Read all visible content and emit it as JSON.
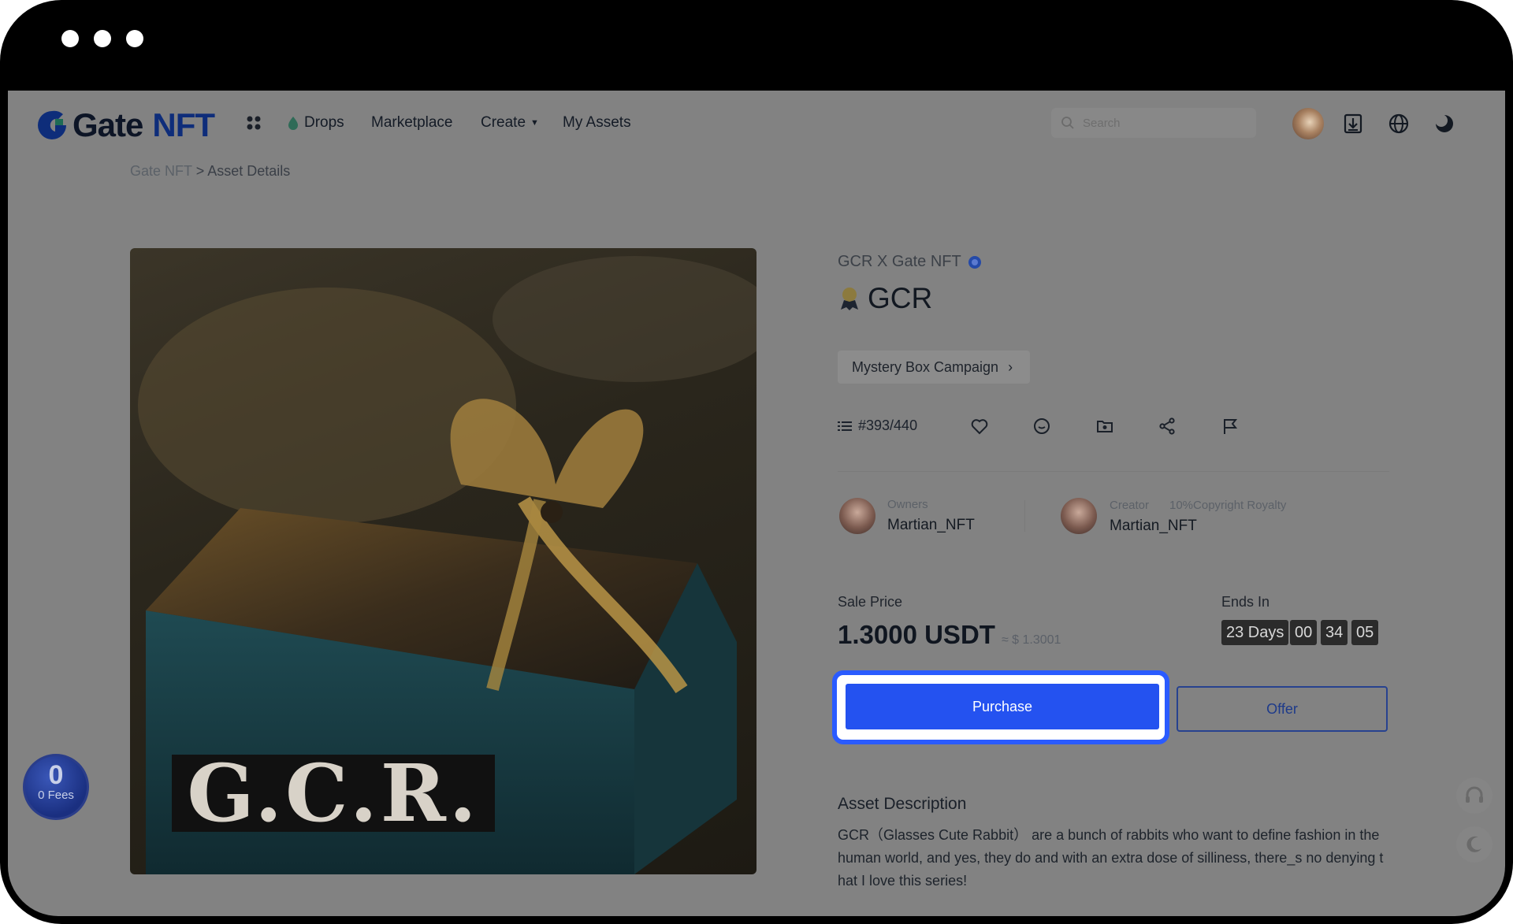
{
  "header": {
    "logo_text": "Gate",
    "logo_text2": "NFT",
    "nav": [
      {
        "label": "Drops"
      },
      {
        "label": "Marketplace"
      },
      {
        "label": "Create"
      },
      {
        "label": "My Assets"
      }
    ],
    "search_placeholder": "Search",
    "icons": [
      "apps-icon",
      "drop-icon",
      "search-icon",
      "download-icon",
      "globe-icon",
      "theme-toggle-icon"
    ]
  },
  "breadcrumb": {
    "root": "Gate NFT",
    "separator": ">",
    "current": "Asset Details"
  },
  "nft_image": {
    "label_text": "G.C.R."
  },
  "asset": {
    "collection": "GCR X Gate NFT",
    "title": "GCR",
    "campaign": "Mystery Box Campaign",
    "edition": "#393/440"
  },
  "owners": {
    "label": "Owners",
    "name": "Martian_NFT"
  },
  "creator": {
    "label": "Creator",
    "royalty": "10%Copyright Royalty",
    "name": "Martian_NFT"
  },
  "sale": {
    "label": "Sale Price",
    "price": "1.3000 USDT",
    "usd": "≈ $ 1.3001",
    "ends_label": "Ends In",
    "days": "23 Days",
    "hours": "00",
    "minutes": "34",
    "seconds": "05"
  },
  "buttons": {
    "purchase": "Purchase",
    "offer": "Offer"
  },
  "description": {
    "heading": "Asset Description",
    "text": "GCR（Glasses Cute Rabbit） are a bunch of rabbits who want to define fashion in the human world, and yes, they do and with an extra dose of silliness, there_s no denying that I love this series!"
  },
  "fees_badge": {
    "number": "0",
    "label": "0 Fees"
  },
  "colors": {
    "accent": "#2452f0",
    "highlight": "#2a5bff",
    "overlay": "#828282"
  }
}
